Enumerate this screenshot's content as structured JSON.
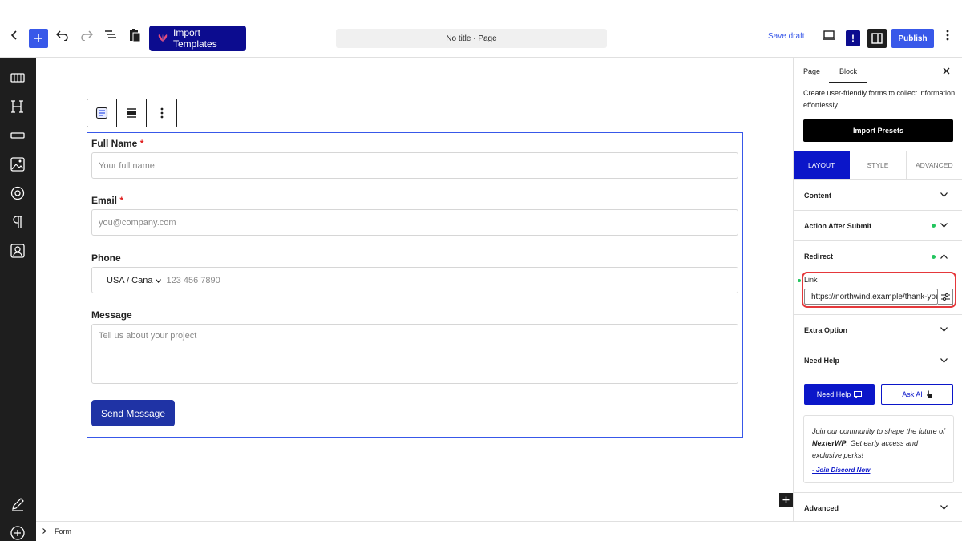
{
  "topbar": {
    "import_label": "Import Templates",
    "doc_title": "No title · Page",
    "save_draft": "Save draft",
    "publish": "Publish",
    "excl": "!"
  },
  "form": {
    "full_name_label": "Full Name",
    "full_name_placeholder": "Your full name",
    "email_label": "Email",
    "email_placeholder": "you@company.com",
    "required_mark": "*",
    "phone_label": "Phone",
    "phone_country": "USA / Cana",
    "phone_placeholder": "123 456 7890",
    "message_label": "Message",
    "message_placeholder": "Tell us about your project",
    "send_label": "Send Message"
  },
  "breadcrumb": {
    "item": "Form"
  },
  "inspector": {
    "tab_page": "Page",
    "tab_block": "Block",
    "description": "Create user-friendly forms to collect information effortlessly.",
    "presets_label": "Import Presets",
    "panel_tabs": [
      "LAYOUT",
      "STYLE",
      "ADVANCED"
    ],
    "content_label": "Content",
    "action_after_submit_label": "Action After Submit",
    "redirect_label": "Redirect",
    "link_label": "Link",
    "link_value": "https://northwind.example/thank-you",
    "extra_option_label": "Extra Option",
    "need_help_label": "Need Help",
    "need_help_button": "Need Help",
    "ask_ai_button": "Ask AI",
    "community_text_1": "Join our community to shape the future of ",
    "community_brand": "NexterWP",
    "community_text_2": ". Get early access and exclusive perks!",
    "discord_link": "- Join Discord Now",
    "advanced_label": "Advanced"
  },
  "colors": {
    "accent": "#3858e9",
    "brand_navy": "#0c0c8f",
    "panel_active": "#0b16c9",
    "highlight_red": "#e5383b",
    "status_green": "#22c55e"
  }
}
